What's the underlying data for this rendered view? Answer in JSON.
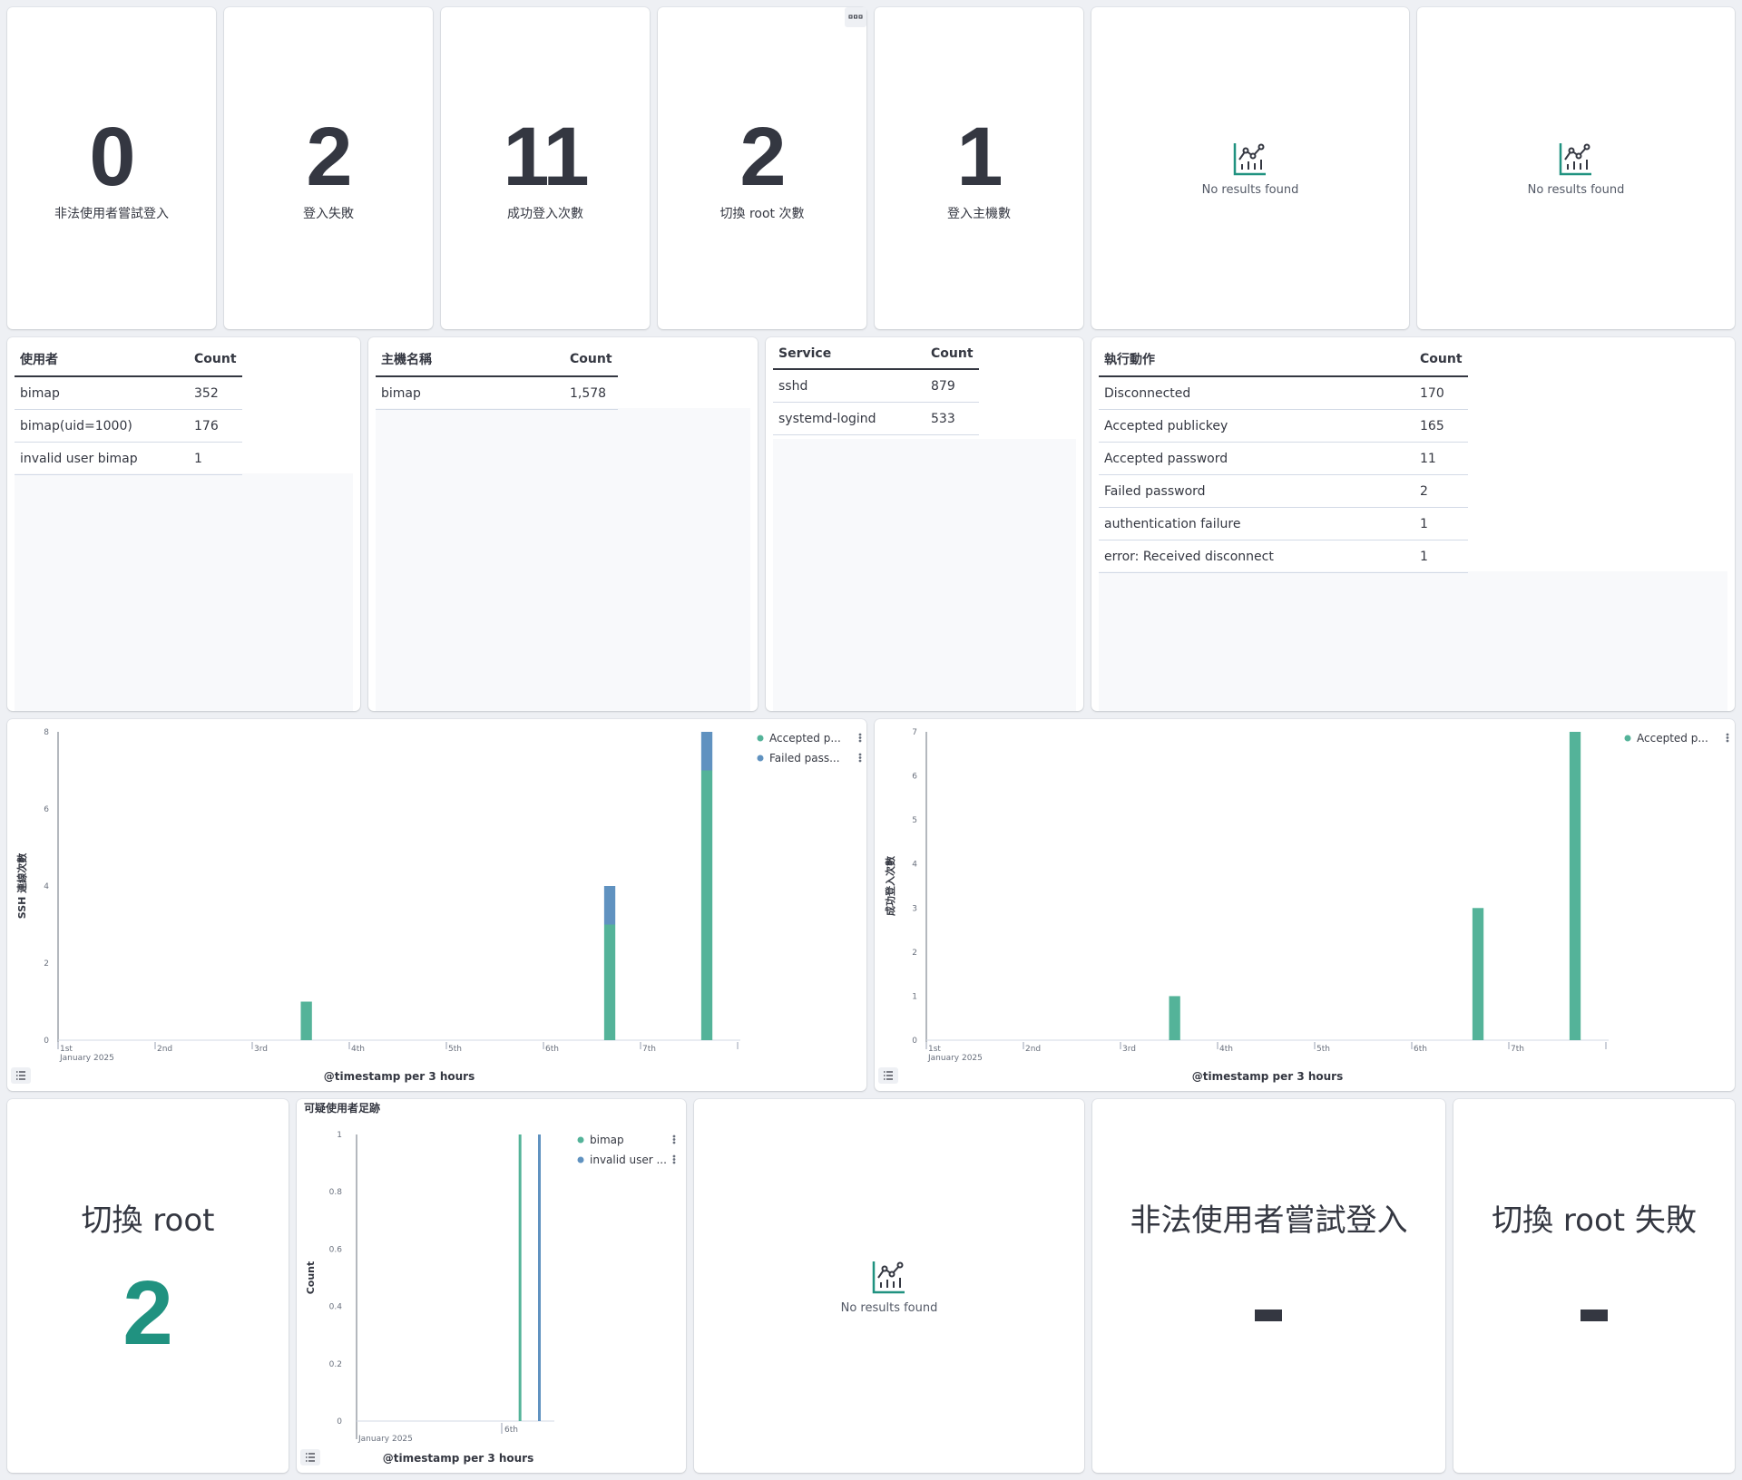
{
  "metrics": [
    {
      "value": "0",
      "label": "非法使用者嘗試登入"
    },
    {
      "value": "2",
      "label": "登入失敗"
    },
    {
      "value": "11",
      "label": "成功登入次數"
    },
    {
      "value": "2",
      "label": "切換 root 次數"
    },
    {
      "value": "1",
      "label": "登入主機數"
    }
  ],
  "no_results_text": "No results found",
  "tables": {
    "users": {
      "headers": [
        "使用者",
        "Count"
      ],
      "rows": [
        [
          "bimap",
          "352"
        ],
        [
          "bimap(uid=1000)",
          "176"
        ],
        [
          "invalid user bimap",
          "1"
        ]
      ]
    },
    "hosts": {
      "headers": [
        "主機名稱",
        "Count"
      ],
      "rows": [
        [
          "bimap",
          "1,578"
        ]
      ]
    },
    "services": {
      "headers": [
        "Service",
        "Count"
      ],
      "rows": [
        [
          "sshd",
          "879"
        ],
        [
          "systemd-logind",
          "533"
        ]
      ]
    },
    "actions": {
      "headers": [
        "執行動作",
        "Count"
      ],
      "rows": [
        [
          "Disconnected",
          "170"
        ],
        [
          "Accepted publickey",
          "165"
        ],
        [
          "Accepted password",
          "11"
        ],
        [
          "Failed password",
          "2"
        ],
        [
          "authentication failure",
          "1"
        ],
        [
          "error: Received disconnect",
          "1"
        ]
      ]
    }
  },
  "bottom": {
    "switch_root": {
      "title": "切換 root",
      "value": "2"
    },
    "illegal_login": {
      "title": "非法使用者嘗試登入",
      "value": "-"
    },
    "switch_root_fail": {
      "title": "切換 root 失敗",
      "value": "-"
    }
  },
  "colors": {
    "green": "#54b399",
    "blue": "#6092c0",
    "teal": "#209280"
  },
  "chart_data": [
    {
      "type": "bar",
      "ylabel": "SSH 連線次數",
      "xlabel": "@timestamp per 3 hours",
      "ylim": [
        0,
        8
      ],
      "yticks": [
        "0",
        "2",
        "4",
        "6",
        "8"
      ],
      "xticks": [
        "1st",
        "2nd",
        "3rd",
        "4th",
        "5th",
        "6th",
        "7th"
      ],
      "xsub": "January 2025",
      "stacked": true,
      "series": [
        {
          "name": "Accepted p...",
          "color": "#54b399",
          "points": [
            {
              "x": "3rd 12:00",
              "y": 1
            },
            {
              "x": "6th 15:00",
              "y": 3
            },
            {
              "x": "7th 15:00",
              "y": 7
            }
          ]
        },
        {
          "name": "Failed pass...",
          "color": "#6092c0",
          "points": [
            {
              "x": "6th 15:00",
              "y": 1
            },
            {
              "x": "7th 15:00",
              "y": 1
            }
          ]
        }
      ],
      "legend": "top-right"
    },
    {
      "type": "bar",
      "ylabel": "成功登入次數",
      "xlabel": "@timestamp per 3 hours",
      "ylim": [
        0,
        7
      ],
      "yticks": [
        "0",
        "1",
        "2",
        "3",
        "4",
        "5",
        "6",
        "7"
      ],
      "xticks": [
        "1st",
        "2nd",
        "3rd",
        "4th",
        "5th",
        "6th",
        "7th"
      ],
      "xsub": "January 2025",
      "stacked": true,
      "series": [
        {
          "name": "Accepted p...",
          "color": "#54b399",
          "points": [
            {
              "x": "3rd 12:00",
              "y": 1
            },
            {
              "x": "6th 15:00",
              "y": 3
            },
            {
              "x": "7th 15:00",
              "y": 7
            }
          ]
        }
      ],
      "legend": "top-right"
    },
    {
      "type": "bar",
      "title": "可疑使用者足跡",
      "ylabel": "Count",
      "xlabel": "@timestamp per 3 hours",
      "ylim": [
        0,
        1
      ],
      "yticks": [
        "0",
        "0.2",
        "0.4",
        "0.6",
        "0.8",
        "1"
      ],
      "xticks": [
        "6th"
      ],
      "xsub": "January 2025",
      "series": [
        {
          "name": "bimap",
          "color": "#54b399",
          "points": [
            {
              "x": "6th 03:00",
              "y": 1
            }
          ]
        },
        {
          "name": "invalid user ...",
          "color": "#6092c0",
          "points": [
            {
              "x": "6th 09:00",
              "y": 1
            }
          ]
        }
      ],
      "legend": "top-right"
    }
  ]
}
